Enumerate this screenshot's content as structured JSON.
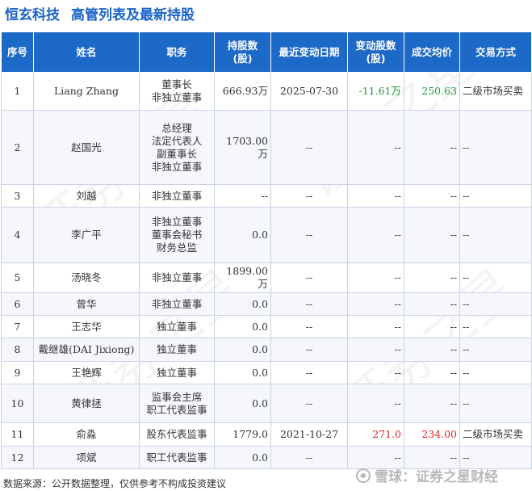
{
  "header": {
    "company": "恒玄科技",
    "subtitle": "高管列表及最新持股"
  },
  "table": {
    "columns": [
      "序号",
      "姓名",
      "职务",
      "持股数\n(股)",
      "最近变动日期",
      "变动股数\n(股)",
      "成交均价",
      "交易方式"
    ],
    "rows": [
      {
        "no": "1",
        "name": "Liang Zhang",
        "titles": [
          "董事长",
          "非独立董事"
        ],
        "holding": "666.93万",
        "date": "2025-07-30",
        "change": "-11.61万",
        "change_sign": "neg",
        "price": "250.63",
        "price_color": "grn",
        "method": "二级市场买卖"
      },
      {
        "no": "2",
        "name": "赵国光",
        "titles": [
          "总经理",
          "法定代表人",
          "副董事长",
          "非独立董事"
        ],
        "holding": "1703.00万",
        "date": "--",
        "change": "--",
        "change_sign": "",
        "price": "--",
        "price_color": "",
        "method": "--"
      },
      {
        "no": "3",
        "name": "刘越",
        "titles": [
          "非独立董事"
        ],
        "holding": "--",
        "date": "--",
        "change": "--",
        "change_sign": "",
        "price": "--",
        "price_color": "",
        "method": "--"
      },
      {
        "no": "4",
        "name": "李广平",
        "titles": [
          "非独立董事",
          "董事会秘书",
          "财务总监"
        ],
        "holding": "0.0",
        "date": "--",
        "change": "--",
        "change_sign": "",
        "price": "--",
        "price_color": "",
        "method": "--"
      },
      {
        "no": "5",
        "name": "汤晓冬",
        "titles": [
          "非独立董事"
        ],
        "holding": "1899.00万",
        "date": "--",
        "change": "--",
        "change_sign": "",
        "price": "--",
        "price_color": "",
        "method": "--"
      },
      {
        "no": "6",
        "name": "曾华",
        "titles": [
          "非独立董事"
        ],
        "holding": "0.0",
        "date": "--",
        "change": "--",
        "change_sign": "",
        "price": "--",
        "price_color": "",
        "method": "--"
      },
      {
        "no": "7",
        "name": "王志华",
        "titles": [
          "独立董事"
        ],
        "holding": "0.0",
        "date": "--",
        "change": "--",
        "change_sign": "",
        "price": "--",
        "price_color": "",
        "method": "--"
      },
      {
        "no": "8",
        "name": "戴继雄(DAI Jixiong)",
        "titles": [
          "独立董事"
        ],
        "holding": "0.0",
        "date": "--",
        "change": "--",
        "change_sign": "",
        "price": "--",
        "price_color": "",
        "method": "--"
      },
      {
        "no": "9",
        "name": "王艳辉",
        "titles": [
          "独立董事"
        ],
        "holding": "0.0",
        "date": "--",
        "change": "--",
        "change_sign": "",
        "price": "--",
        "price_color": "",
        "method": "--"
      },
      {
        "no": "10",
        "name": "黄律拯",
        "titles": [
          "监事会主席",
          "职工代表监事"
        ],
        "holding": "0.0",
        "date": "--",
        "change": "--",
        "change_sign": "",
        "price": "--",
        "price_color": "",
        "method": "--"
      },
      {
        "no": "11",
        "name": "俞淼",
        "titles": [
          "股东代表监事"
        ],
        "holding": "1779.0",
        "date": "2021-10-27",
        "change": "271.0",
        "change_sign": "pos",
        "price": "234.00",
        "price_color": "red",
        "method": "二级市场买卖"
      },
      {
        "no": "12",
        "name": "项斌",
        "titles": [
          "职工代表监事"
        ],
        "holding": "0.0",
        "date": "--",
        "change": "--",
        "change_sign": "",
        "price": "--",
        "price_color": "",
        "method": "--"
      }
    ]
  },
  "footer": {
    "source": "数据来源：公开数据整理，仅供参考不构成投资建议",
    "brand": "雪球：证券之星财经"
  },
  "watermark": "证券之星",
  "colors": {
    "accent": "#1d69c7",
    "title": "#1a64c8",
    "negative": "#1c9a3a",
    "positive": "#d9242a"
  }
}
